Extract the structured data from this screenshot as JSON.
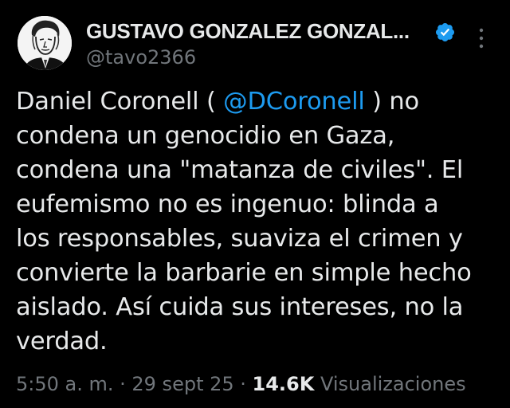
{
  "author": {
    "display_name": "GUSTAVO GONZALEZ GONZAL...",
    "handle": "@tavo2366",
    "verified": true,
    "avatar_icon": "portrait-sketch-icon"
  },
  "more_icon": "more-vertical-icon",
  "tweet": {
    "lines": [
      {
        "before": "Daniel Coronell ( ",
        "mention": "@DCoronell",
        "after": " ) no"
      },
      {
        "text": "condena un genocidio en Gaza,"
      },
      {
        "text": "condena una \"matanza de civiles\". El"
      },
      {
        "text": "eufemismo no es ingenuo: blinda a"
      },
      {
        "text": "los responsables, suaviza el crimen y"
      },
      {
        "text": "convierte la barbarie en simple hecho"
      },
      {
        "text": "aislado. Así cuida sus intereses, no la"
      },
      {
        "text": "verdad."
      }
    ]
  },
  "meta": {
    "time": "5:50 a. m.",
    "separator": " · ",
    "date": "29 sept 25",
    "views_count": "14.6K",
    "views_label": " Visualizaciones"
  },
  "colors": {
    "background": "#000000",
    "text": "#e7e9ea",
    "secondary": "#71767b",
    "accent": "#1d9bf0"
  }
}
